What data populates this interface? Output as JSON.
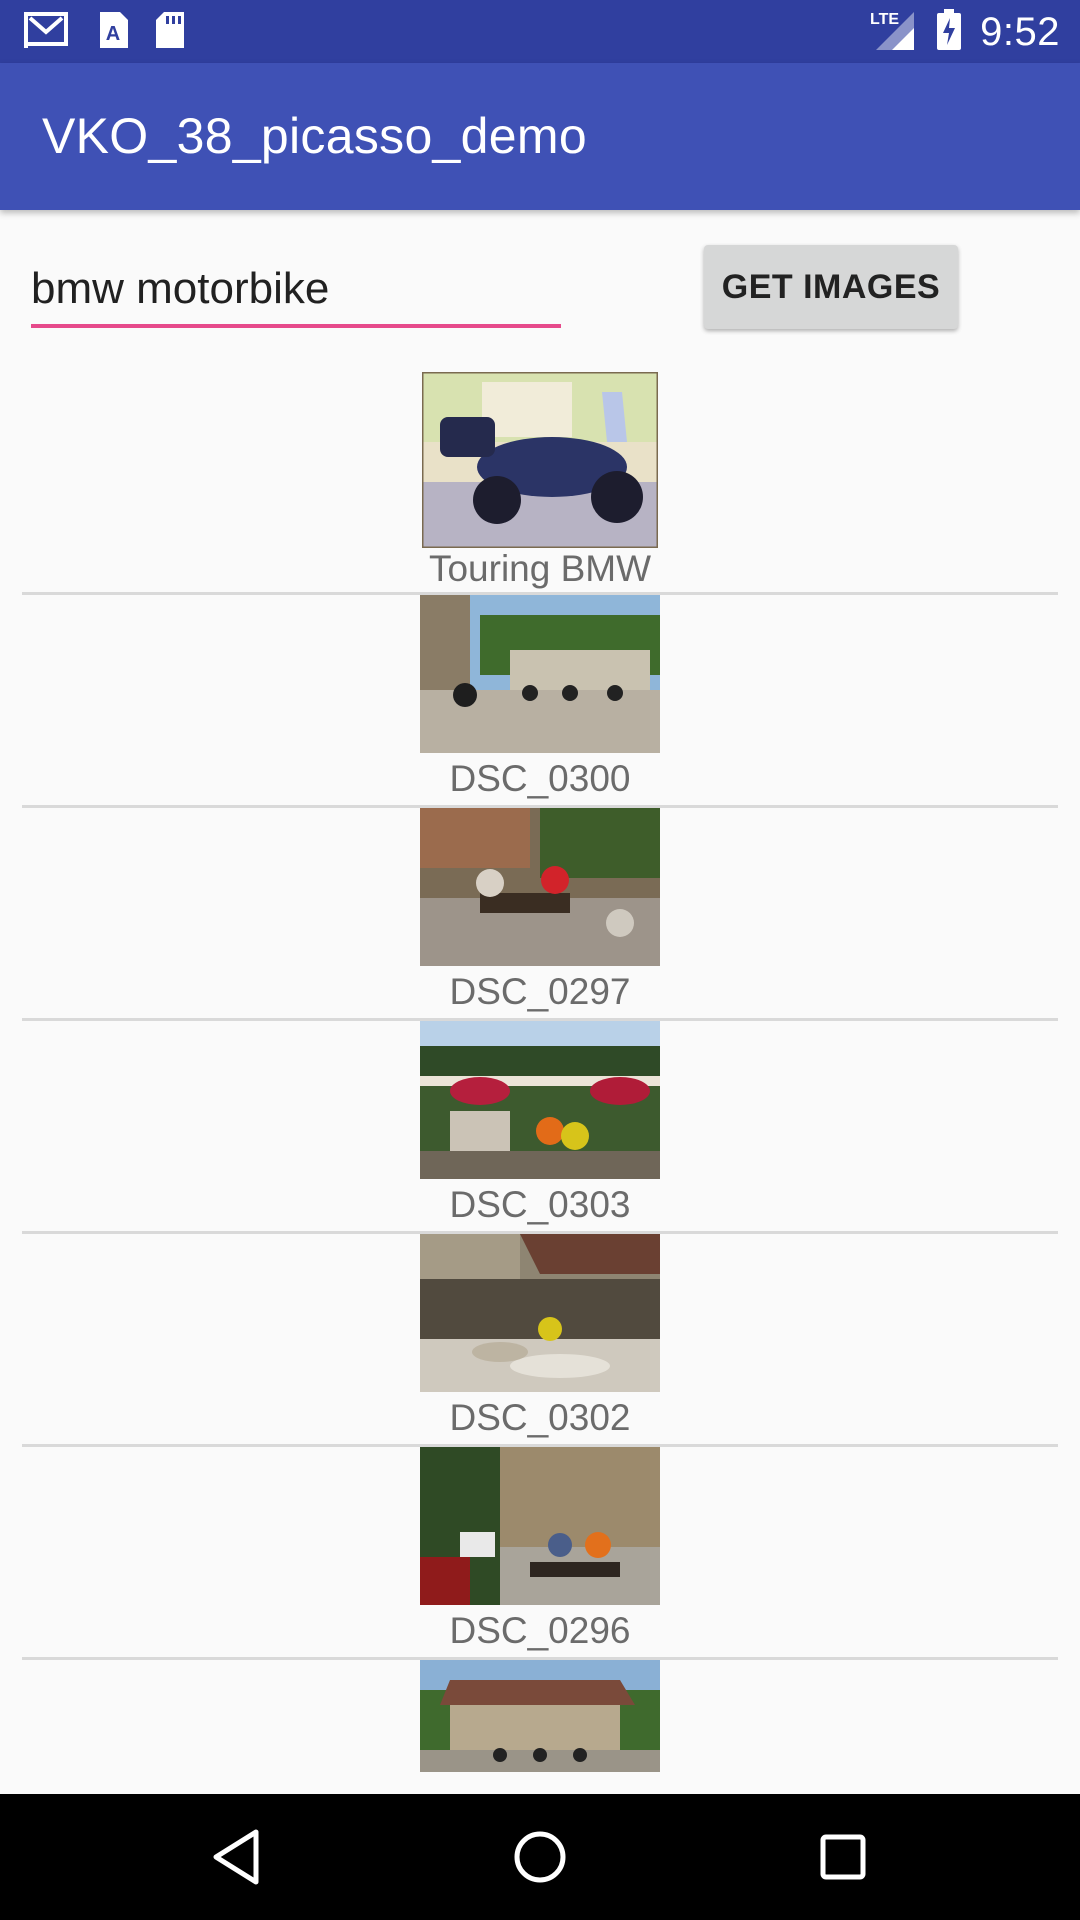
{
  "status_bar": {
    "icons": [
      "gmail-icon",
      "font-a-icon",
      "sd-card-icon"
    ],
    "network": "LTE",
    "time": "9:52"
  },
  "app_bar": {
    "title": "VKO_38_picasso_demo"
  },
  "search": {
    "value": "bmw motorbike"
  },
  "get_images_button": {
    "label": "GET IMAGES"
  },
  "images": [
    {
      "caption": "Touring BMW"
    },
    {
      "caption": "DSC_0300"
    },
    {
      "caption": "DSC_0297"
    },
    {
      "caption": "DSC_0303"
    },
    {
      "caption": "DSC_0302"
    },
    {
      "caption": "DSC_0296"
    },
    {
      "caption": ""
    }
  ],
  "colors": {
    "status_bar": "#303f9f",
    "app_bar": "#3f51b5",
    "accent_underline": "#e64a8b",
    "button": "#d6d7d7"
  },
  "nav_bar": {
    "buttons": [
      "back-icon",
      "home-icon",
      "recents-icon"
    ]
  }
}
